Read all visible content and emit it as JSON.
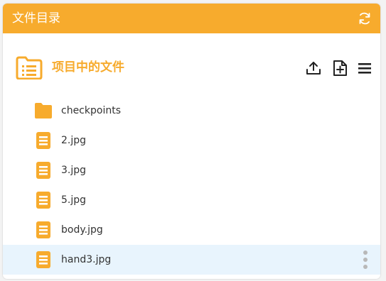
{
  "colors": {
    "accent": "#f7ab2d",
    "selected_row": "#e8f4fd",
    "text": "#333333"
  },
  "header": {
    "title": "文件目录",
    "refresh_icon": "refresh-icon"
  },
  "toolbar": {
    "title": "项目中的文件",
    "folder_icon": "folder-list-icon",
    "upload_icon": "upload-icon",
    "new_file_icon": "new-file-icon",
    "menu_icon": "menu-icon"
  },
  "files": [
    {
      "name": "checkpoints",
      "type": "folder",
      "icon": "folder-icon",
      "selected": false
    },
    {
      "name": "2.jpg",
      "type": "file",
      "icon": "file-icon",
      "selected": false
    },
    {
      "name": "3.jpg",
      "type": "file",
      "icon": "file-icon",
      "selected": false
    },
    {
      "name": "5.jpg",
      "type": "file",
      "icon": "file-icon",
      "selected": false
    },
    {
      "name": "body.jpg",
      "type": "file",
      "icon": "file-icon",
      "selected": false
    },
    {
      "name": "hand3.jpg",
      "type": "file",
      "icon": "file-icon",
      "selected": true,
      "more_icon": "more-vertical-icon"
    }
  ]
}
